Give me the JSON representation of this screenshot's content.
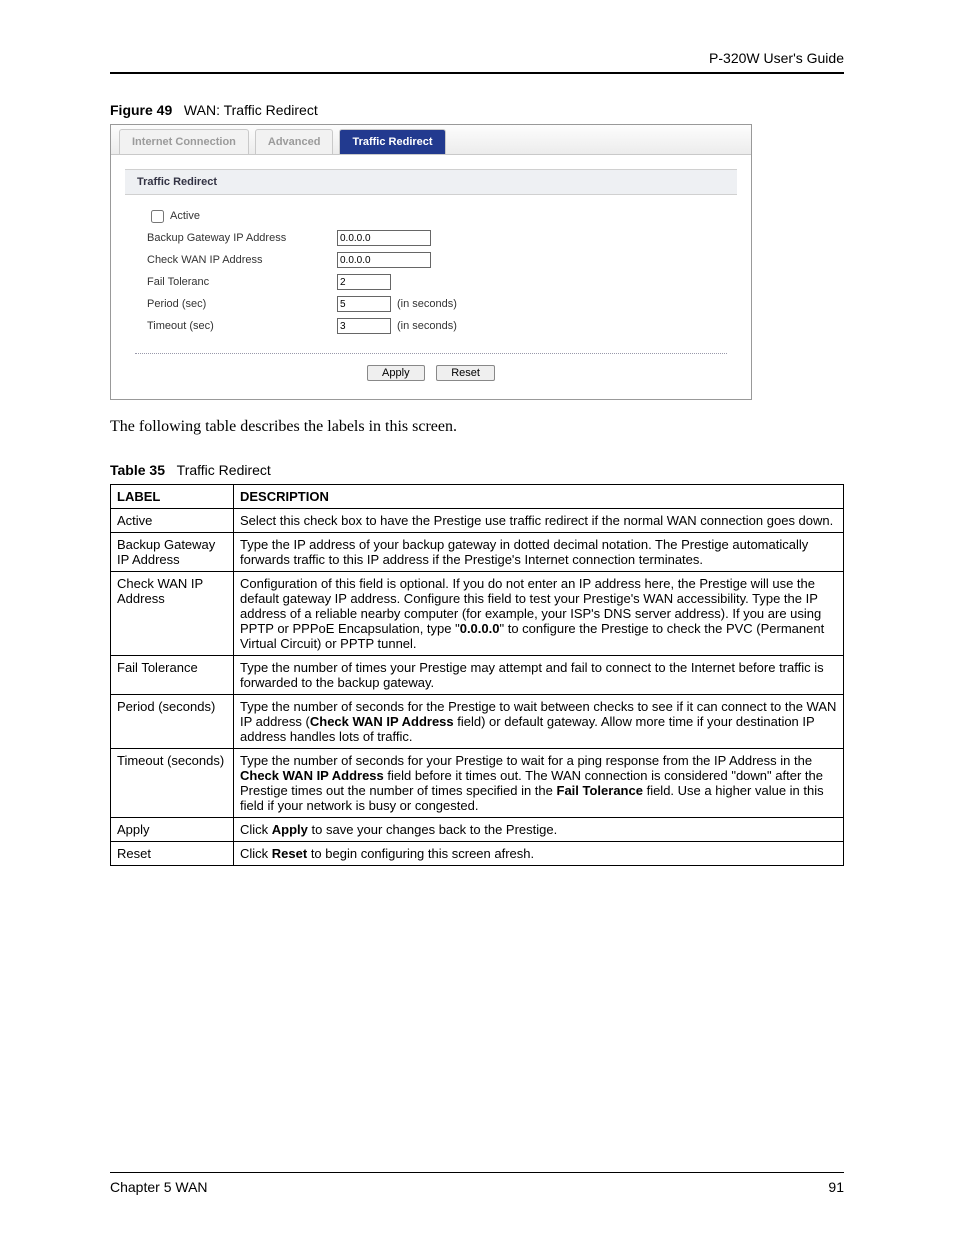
{
  "header": {
    "doc_title": "P-320W User's Guide"
  },
  "figure": {
    "label": "Figure 49",
    "title": "WAN: Traffic Redirect"
  },
  "screenshot": {
    "tabs": {
      "internet": "Internet Connection",
      "advanced": "Advanced",
      "traffic": "Traffic Redirect"
    },
    "panel_title": "Traffic Redirect",
    "fields": {
      "active": "Active",
      "backup": "Backup Gateway IP Address",
      "checkwan": "Check WAN IP Address",
      "failtol": "Fail Toleranc",
      "period": "Period (sec)",
      "timeout": "Timeout (sec)"
    },
    "values": {
      "backup": "0.0.0.0",
      "checkwan": "0.0.0.0",
      "failtol": "2",
      "period": "5",
      "timeout": "3"
    },
    "suffix": "(in seconds)",
    "buttons": {
      "apply": "Apply",
      "reset": "Reset"
    }
  },
  "intro_text": "The following table describes the labels in this screen.",
  "table": {
    "label": "Table 35",
    "title": "Traffic Redirect",
    "headers": {
      "label": "LABEL",
      "description": "DESCRIPTION"
    },
    "rows": [
      {
        "label": "Active",
        "desc": "Select this check box to have the Prestige use traffic redirect if the normal WAN connection goes down."
      },
      {
        "label": "Backup Gateway IP Address",
        "desc": "Type the IP address of your backup gateway in dotted decimal notation. The Prestige automatically forwards traffic to this IP address if the Prestige's Internet connection terminates."
      },
      {
        "label": "Check WAN IP Address",
        "desc_pre": "Configuration of this field is optional. If you do not enter an IP address here, the Prestige will use the default gateway IP address. Configure this field to test your Prestige's WAN accessibility. Type the IP address of a reliable nearby computer (for example, your ISP's DNS server address). If you are using PPTP or PPPoE Encapsulation, type \"",
        "desc_bold": "0.0.0.0",
        "desc_post": "\" to configure the Prestige to check the PVC (Permanent Virtual Circuit) or PPTP tunnel."
      },
      {
        "label": "Fail Tolerance",
        "desc": "Type the number of times your Prestige may attempt and fail to connect to the Internet before traffic is forwarded to the backup gateway."
      },
      {
        "label": "Period (seconds)",
        "desc_pre": "Type the number of seconds for the Prestige to wait between checks to see if it can connect to the WAN IP address (",
        "desc_bold": "Check WAN IP Address",
        "desc_post": " field) or default gateway. Allow more time if your destination IP address handles lots of traffic."
      },
      {
        "label": "Timeout (seconds)",
        "desc_pre": "Type the number of seconds for your Prestige to wait for a ping response from the IP Address in the ",
        "desc_bold": "Check WAN IP Address",
        "desc_mid": " field before it times out. The WAN connection is considered \"down\" after the Prestige times out the number of times specified in the ",
        "desc_bold2": "Fail Tolerance",
        "desc_post": " field. Use a higher value in this field if your network is busy or congested."
      },
      {
        "label": "Apply",
        "desc_pre": "Click ",
        "desc_bold": "Apply",
        "desc_post": " to save your changes back to the Prestige."
      },
      {
        "label": "Reset",
        "desc_pre": "Click ",
        "desc_bold": "Reset",
        "desc_post": " to begin configuring this screen afresh."
      }
    ]
  },
  "footer": {
    "chapter": "Chapter 5 WAN",
    "page": "91"
  }
}
